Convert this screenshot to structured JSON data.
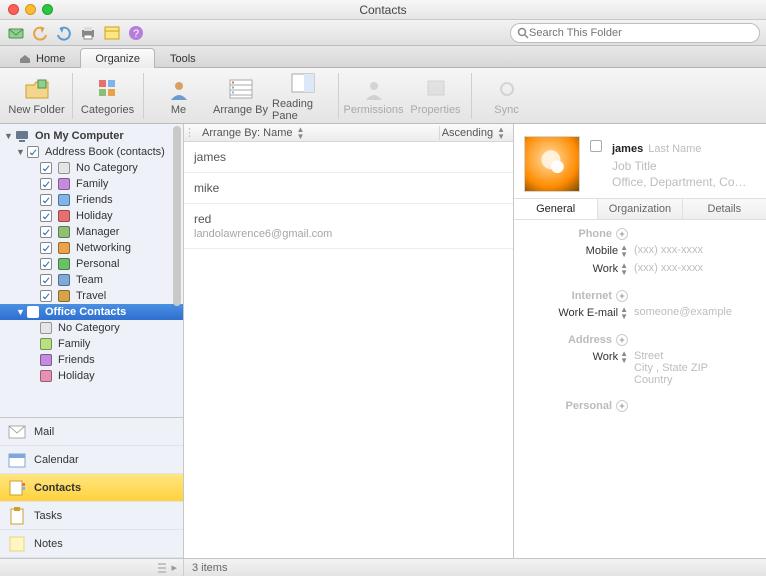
{
  "window": {
    "title": "Contacts"
  },
  "search": {
    "placeholder": "Search This Folder"
  },
  "tabs": {
    "home": "Home",
    "organize": "Organize",
    "tools": "Tools"
  },
  "ribbon": {
    "new_folder": "New Folder",
    "categories": "Categories",
    "me": "Me",
    "arrange_by": "Arrange By",
    "reading_pane": "Reading Pane",
    "permissions": "Permissions",
    "properties": "Properties",
    "sync": "Sync"
  },
  "sidebar": {
    "root": "On My Computer",
    "book": "Address Book (contacts)",
    "cats": [
      "No Category",
      "Family",
      "Friends",
      "Holiday",
      "Manager",
      "Networking",
      "Personal",
      "Team",
      "Travel"
    ],
    "cat_colors": [
      "#e5e5e5",
      "#c58bde",
      "#7fb4e8",
      "#e86f6f",
      "#8cbf73",
      "#e8a24a",
      "#6bbf6b",
      "#7fa8d9",
      "#d4a24a"
    ],
    "office": "Office Contacts",
    "off_cats": [
      "No Category",
      "Family",
      "Friends",
      "Holiday"
    ],
    "off_colors": [
      "#e5e5e5",
      "#b7e27f",
      "#c58bde",
      "#e88fb4"
    ]
  },
  "nav": {
    "mail": "Mail",
    "calendar": "Calendar",
    "contacts": "Contacts",
    "tasks": "Tasks",
    "notes": "Notes"
  },
  "listhdr": {
    "arrange": "Arrange By: Name",
    "order": "Ascending"
  },
  "contacts": [
    {
      "name": "james",
      "sub": ""
    },
    {
      "name": "mike",
      "sub": ""
    },
    {
      "name": "red",
      "sub": "landolawrence6@gmail.com"
    }
  ],
  "detail": {
    "first": "james",
    "last": "Last Name",
    "jobtitle": "Job Title",
    "meta": "Office, Department, Company",
    "tabs": {
      "general": "General",
      "organization": "Organization",
      "details": "Details"
    },
    "phone_h": "Phone",
    "phone": [
      {
        "label": "Mobile",
        "value": "(xxx) xxx-xxxx"
      },
      {
        "label": "Work",
        "value": "(xxx) xxx-xxxx"
      }
    ],
    "internet_h": "Internet",
    "internet": [
      {
        "label": "Work E-mail",
        "value": "someone@example"
      }
    ],
    "address_h": "Address",
    "address": [
      {
        "label": "Work",
        "value": "Street\nCity , State ZIP\nCountry"
      }
    ],
    "personal_h": "Personal"
  },
  "status": {
    "count": "3 items"
  }
}
